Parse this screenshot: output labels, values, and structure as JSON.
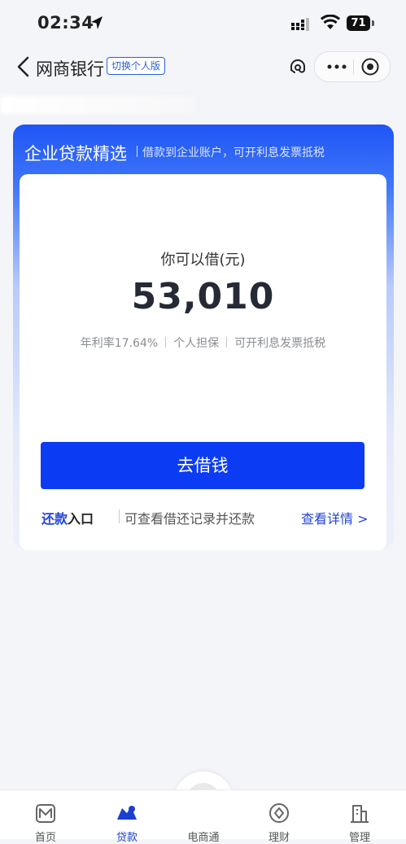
{
  "status_bar": {
    "time": "02:34",
    "battery": "71"
  },
  "nav": {
    "title": "网商银行",
    "switch_label": "切换个人版"
  },
  "loan_card": {
    "title": "企业贷款精选",
    "subtitle": "借款到企业账户，可开利息发票抵税",
    "borrow_label": "你可以借(元)",
    "amount": "53,010",
    "features": [
      "年利率17.64%",
      "个人担保",
      "可开利息发票抵税"
    ],
    "borrow_button": "去借钱",
    "repay_entry_bold": "还款",
    "repay_entry_rest": "入口",
    "repay_desc": "可查看借还记录并还款",
    "detail_link": "查看详情 >"
  },
  "tabs": [
    {
      "label": "首页",
      "icon": "home-icon",
      "active": false
    },
    {
      "label": "贷款",
      "icon": "loan-icon",
      "active": true
    },
    {
      "label": "电商通",
      "icon": "ecommerce-icon",
      "active": false
    },
    {
      "label": "理财",
      "icon": "wealth-icon",
      "active": false
    },
    {
      "label": "管理",
      "icon": "management-icon",
      "active": false
    }
  ],
  "colors": {
    "primary_blue": "#0b3cf4",
    "card_header_blue": "#1f55f5",
    "link_blue": "#2345d8",
    "background": "#f4f5f8"
  }
}
